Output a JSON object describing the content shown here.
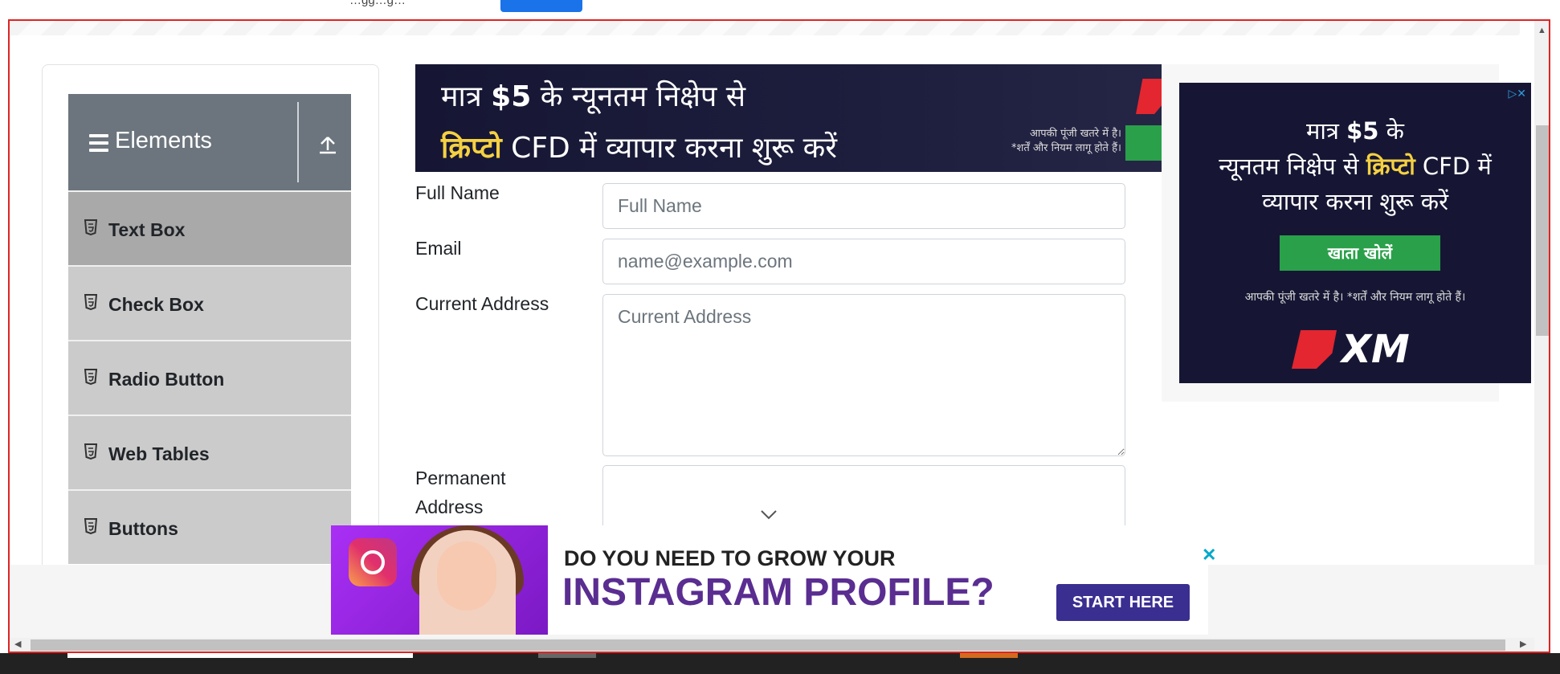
{
  "top": {
    "cut_text": "…gg…g…"
  },
  "sidebar": {
    "header_title": "Elements",
    "items": [
      {
        "label": "Text Box",
        "active": true
      },
      {
        "label": "Check Box",
        "active": false
      },
      {
        "label": "Radio Button",
        "active": false
      },
      {
        "label": "Web Tables",
        "active": false
      },
      {
        "label": "Buttons",
        "active": false
      }
    ]
  },
  "ad_top": {
    "line1_pre": "मात्र ",
    "line1_amount": "$5",
    "line1_post": " के न्यूनतम निक्षेप से",
    "line2_highlight": "क्रिप्टो",
    "line2_post": " CFD में  व्यापार करना शुरू करें",
    "disclaimer_1": "आपकी पूंजी खतरे में है।",
    "disclaimer_2": "*शर्तें और नियम लागू होते हैं।"
  },
  "form": {
    "full_name": {
      "label": "Full Name",
      "placeholder": "Full Name",
      "value": ""
    },
    "email": {
      "label": "Email",
      "placeholder": "name@example.com",
      "value": ""
    },
    "current_address": {
      "label": "Current Address",
      "placeholder": "Current Address",
      "value": ""
    },
    "permanent_address": {
      "label_line1": "Permanent",
      "label_line2": "Address",
      "value": ""
    }
  },
  "ad_right": {
    "line1_pre": "मात्र ",
    "line1_amount": "$5",
    "line1_post": " के",
    "line2_pre": "न्यूनतम निक्षेप से ",
    "line2_highlight": "क्रिप्टो",
    "line2_post": " CFD में",
    "line3": "व्यापार करना शुरू करें",
    "button": "खाता खोलें",
    "disclaimer": "आपकी पूंजी खतरे में है। *शर्तें और नियम लागू होते हैं।",
    "brand": "XM"
  },
  "ad_bottom": {
    "headline_1": "DO YOU NEED TO GROW YOUR",
    "headline_2": "INSTAGRAM PROFILE?",
    "cta": "START HERE",
    "close_symbol": "✕"
  },
  "colors": {
    "sidebar_header": "#6c757d",
    "menu_item": "#cbcbcb",
    "menu_item_active": "#a9a9a9",
    "frame_outline": "#e02424",
    "ad_green": "#2aa04a",
    "ad_highlight": "#f5d142",
    "instagram_purple": "#5a2d91"
  }
}
